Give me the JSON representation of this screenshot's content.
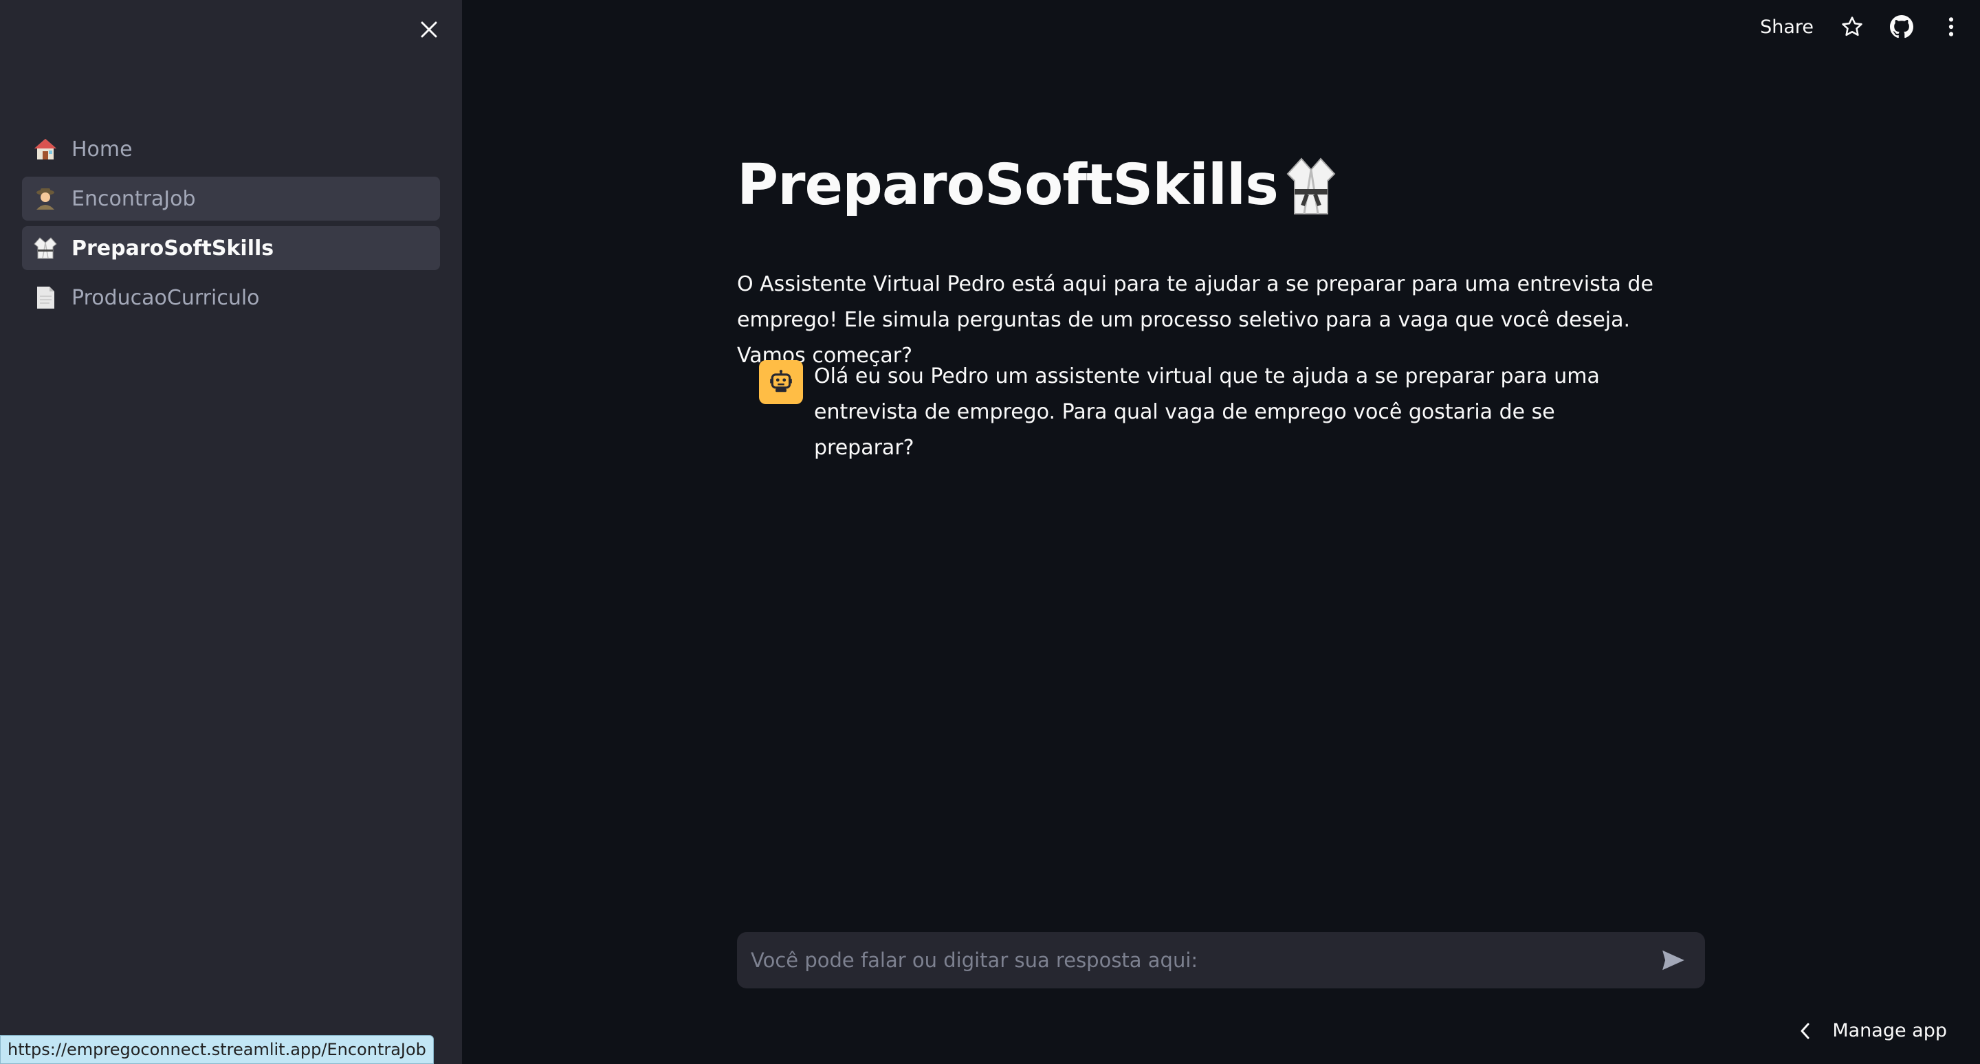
{
  "sidebar": {
    "close_icon": "close-icon",
    "items": [
      {
        "label": "Home",
        "icon": "house-icon",
        "state": "normal"
      },
      {
        "label": "EncontraJob",
        "icon": "detective-icon",
        "state": "hover"
      },
      {
        "label": "PreparoSoftSkills",
        "icon": "martial-arts-uniform-icon",
        "state": "active"
      },
      {
        "label": "ProducaoCurriculo",
        "icon": "page-icon",
        "state": "normal"
      }
    ]
  },
  "toolbar": {
    "share_label": "Share",
    "icons": [
      "star-icon",
      "github-icon",
      "more-vertical-icon"
    ]
  },
  "main": {
    "title": "PreparoSoftSkills",
    "title_icon": "martial-arts-uniform-icon",
    "intro": "O Assistente Virtual Pedro está aqui para te ajudar a se preparar para uma entrevista de emprego! Ele simula perguntas de um processo seletivo para a vaga que você deseja. Vamos começar?"
  },
  "chat": {
    "messages": [
      {
        "role": "assistant",
        "avatar_icon": "robot-icon",
        "text": "Olá eu sou Pedro um assistente virtual que te ajuda a se preparar para uma entrevista de emprego. Para qual vaga de emprego você gostaria de se preparar?"
      }
    ],
    "input": {
      "placeholder": "Você pode falar ou digitar sua resposta aqui:",
      "value": ""
    },
    "send_icon": "send-icon"
  },
  "footer": {
    "manage_app_label": "Manage app",
    "status_url": "https://empregoconnect.streamlit.app/EncontraJob"
  },
  "colors": {
    "background": "#0e1117",
    "sidebar": "#262730",
    "avatar": "#ffbd45",
    "text": "#fafafa"
  }
}
